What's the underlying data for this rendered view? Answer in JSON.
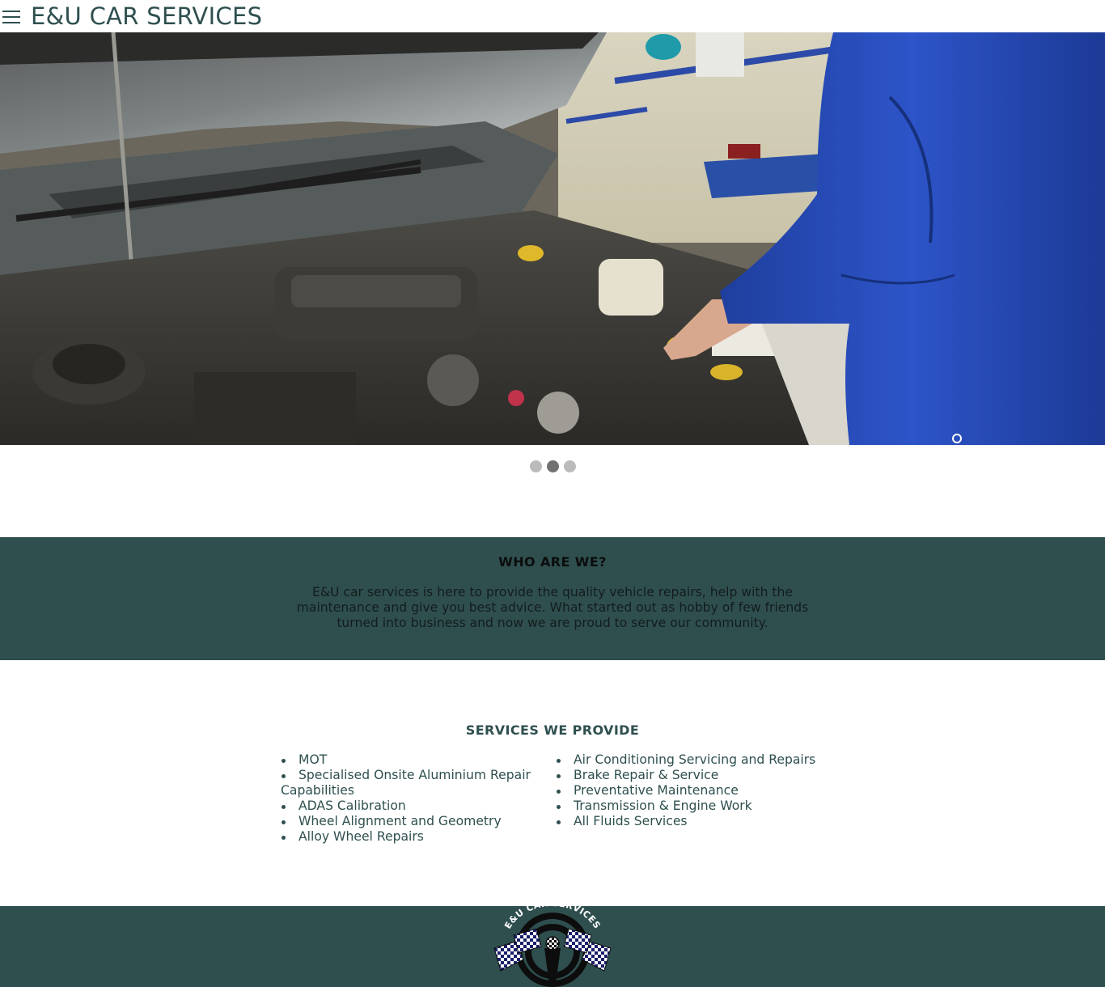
{
  "header": {
    "menu_icon": "hamburger-icon",
    "title": "E&U CAR SERVICES"
  },
  "hero": {
    "slide_count": 3,
    "active_slide": 2
  },
  "about": {
    "heading": "WHO ARE WE?",
    "body": "E&U car services is here to provide the quality vehicle repairs, help with the maintenance and give you best advice. What started out as hobby of few friends turned into business and now we are proud to serve our community."
  },
  "services": {
    "heading": "SERVICES WE PROVIDE",
    "left": [
      "MOT",
      "Specialised Onsite Aluminium Repair Capabilities",
      "ADAS Calibration",
      "Wheel Alignment and Geometry",
      "Alloy Wheel Repairs"
    ],
    "right": [
      "Air Conditioning Servicing and Repairs",
      "Brake Repair & Service",
      "Preventative Maintenance",
      "Transmission & Engine Work",
      "All Fluids Services"
    ]
  },
  "footer": {
    "logo_text": "E&U CAR SERVICES"
  },
  "colors": {
    "brand_dark": "#2f4f4f",
    "dot_inactive": "#bbbbbb",
    "dot_active": "#717171"
  }
}
